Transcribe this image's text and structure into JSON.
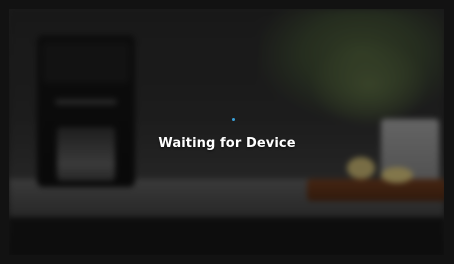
{
  "status": {
    "message": "Waiting for Device"
  },
  "colors": {
    "accent": "#3aa0d8",
    "text": "#ffffff"
  },
  "icons": {
    "loading": "loading-spinner-icon"
  }
}
